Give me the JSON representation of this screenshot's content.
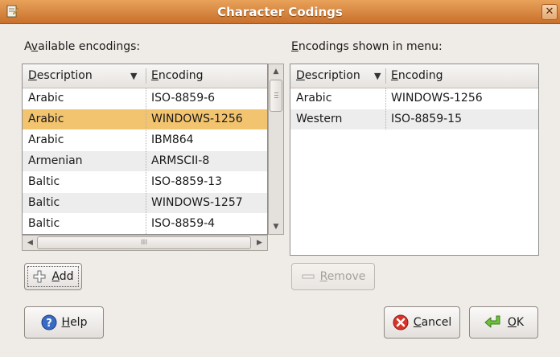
{
  "window": {
    "title": "Character Codings",
    "close_glyph": "✕"
  },
  "available": {
    "label_pre": "A",
    "label_u": "v",
    "label_post": "ailable encodings:",
    "columns": {
      "description_u": "D",
      "description_rest": "escription",
      "encoding_u": "E",
      "encoding_rest": "ncoding"
    },
    "rows": [
      {
        "description": "Arabic",
        "encoding": "ISO-8859-6",
        "state": "normal"
      },
      {
        "description": "Arabic",
        "encoding": "WINDOWS-1256",
        "state": "selected"
      },
      {
        "description": "Arabic",
        "encoding": "IBM864",
        "state": "normal"
      },
      {
        "description": "Armenian",
        "encoding": "ARMSCII-8",
        "state": "alt"
      },
      {
        "description": "Baltic",
        "encoding": "ISO-8859-13",
        "state": "normal"
      },
      {
        "description": "Baltic",
        "encoding": "WINDOWS-1257",
        "state": "alt"
      },
      {
        "description": "Baltic",
        "encoding": "ISO-8859-4",
        "state": "normal"
      }
    ],
    "hscroll_grip": "III"
  },
  "shown": {
    "label_u": "E",
    "label_post": "ncodings shown in menu:",
    "columns": {
      "description_u": "D",
      "description_rest": "escription",
      "encoding_u": "E",
      "encoding_rest": "ncoding"
    },
    "rows": [
      {
        "description": "Arabic",
        "encoding": "WINDOWS-1256",
        "state": "normal"
      },
      {
        "description": "Western",
        "encoding": "ISO-8859-15",
        "state": "alt"
      }
    ]
  },
  "buttons": {
    "add": {
      "u": "A",
      "rest": "dd",
      "icon": "add-icon"
    },
    "remove": {
      "u": "R",
      "rest": "emove",
      "icon": "remove-icon"
    },
    "help": {
      "u": "H",
      "rest": "elp",
      "icon": "help-icon"
    },
    "cancel": {
      "u": "C",
      "rest": "ancel",
      "icon": "cancel-icon"
    },
    "ok": {
      "u": "O",
      "rest": "K",
      "icon": "ok-icon"
    }
  },
  "colors": {
    "selection": "#f3c46f",
    "titlebar": "#d6823c",
    "alt_row": "#ededed"
  }
}
